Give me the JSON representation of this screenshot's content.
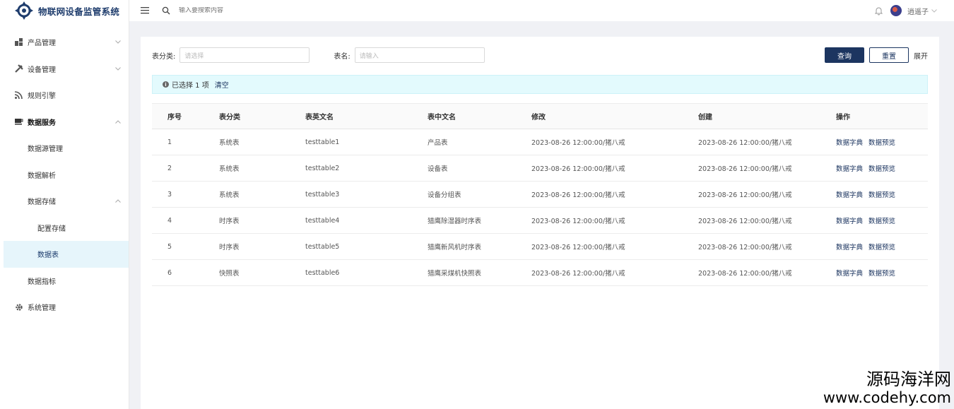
{
  "app": {
    "title": "物联网设备监管系统"
  },
  "header": {
    "search_placeholder": "输入要搜索内容",
    "username": "逍遥子"
  },
  "sidebar": {
    "items": [
      {
        "label": "产品管理",
        "icon": "product-icon"
      },
      {
        "label": "设备管理",
        "icon": "tools-icon"
      },
      {
        "label": "规则引擎",
        "icon": "rss-icon"
      },
      {
        "label": "数据服务",
        "icon": "cup-icon"
      },
      {
        "label": "数据源管理"
      },
      {
        "label": "数据解析"
      },
      {
        "label": "数据存储"
      },
      {
        "label": "配置存储"
      },
      {
        "label": "数据表"
      },
      {
        "label": "数据指标"
      },
      {
        "label": "系统管理",
        "icon": "gear-icon"
      }
    ]
  },
  "filters": {
    "category_label": "表分类:",
    "category_placeholder": "请选择",
    "name_label": "表名:",
    "name_placeholder": "请输入",
    "query_label": "查询",
    "reset_label": "重置",
    "expand_label": "展开"
  },
  "alert": {
    "text": "已选择 1 项",
    "clear_label": "清空"
  },
  "table": {
    "headers": [
      "序号",
      "表分类",
      "表英文名",
      "表中文名",
      "修改",
      "创建",
      "操作"
    ],
    "rows": [
      [
        "1",
        "系统表",
        "testtable1",
        "产品表",
        "2023-08-26 12:00:00/猪八戒",
        "2023-08-26 12:00:00/猪八戒"
      ],
      [
        "2",
        "系统表",
        "testtable2",
        "设备表",
        "2023-08-26 12:00:00/猪八戒",
        "2023-08-26 12:00:00/猪八戒"
      ],
      [
        "3",
        "系统表",
        "testtable3",
        "设备分组表",
        "2023-08-26 12:00:00/猪八戒",
        "2023-08-26 12:00:00/猪八戒"
      ],
      [
        "4",
        "时序表",
        "testtable4",
        "猎鹰除湿器时序表",
        "2023-08-26 12:00:00/猪八戒",
        "2023-08-26 12:00:00/猪八戒"
      ],
      [
        "5",
        "时序表",
        "testtable5",
        "猎鹰新风机时序表",
        "2023-08-26 12:00:00/猪八戒",
        "2023-08-26 12:00:00/猪八戒"
      ],
      [
        "6",
        "快照表",
        "testtable6",
        "猎鹰采煤机快照表",
        "2023-08-26 12:00:00/猪八戒",
        "2023-08-26 12:00:00/猪八戒"
      ]
    ],
    "op_dict": "数据字典",
    "op_preview": "数据预览"
  },
  "watermark": {
    "line1": "源码海洋网",
    "line2": "www.codehy.com"
  },
  "colors": {
    "primary": "#1c3560",
    "alert_bg": "#e3fafd",
    "selected_bg": "#e6f5fb"
  }
}
